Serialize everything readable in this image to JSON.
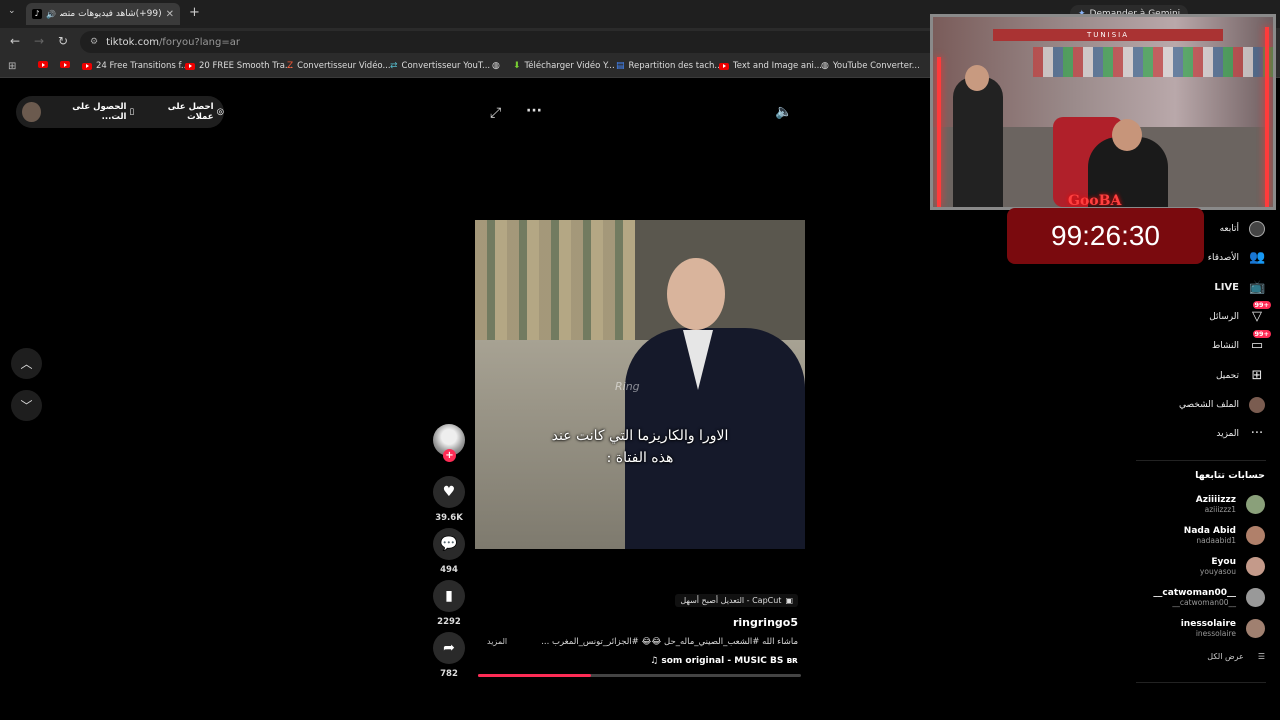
{
  "browser": {
    "tab_title": "(99+)شاهد فيديوهات متصدر",
    "new_tab": "+",
    "gemini_label": "Demander à Gemini",
    "url_host": "tiktok.com",
    "url_path": "/foryou?lang=ar"
  },
  "bookmarks": [
    {
      "label": "",
      "icon": "youtube-icon"
    },
    {
      "label": "",
      "icon": "youtube-icon"
    },
    {
      "label": "24 Free Transitions f...",
      "icon": "youtube-icon"
    },
    {
      "label": "20 FREE Smooth Tra...",
      "icon": "youtube-icon"
    },
    {
      "label": "Convertisseur Vidéo...",
      "icon": "z-icon"
    },
    {
      "label": "Convertisseur YouT...",
      "icon": "arrows-icon"
    },
    {
      "label": "",
      "icon": "globe-icon"
    },
    {
      "label": "Télécharger Vidéo Y...",
      "icon": "download-icon"
    },
    {
      "label": "Repartition des tach...",
      "icon": "docs-icon"
    },
    {
      "label": "Text and Image ani...",
      "icon": "youtube-icon"
    },
    {
      "label": "YouTube Converter...",
      "icon": "globe-icon"
    }
  ],
  "promo": {
    "get_coins": "احصل على عملات",
    "get_app": "الحصول على الت..."
  },
  "video": {
    "caption_line1": "الاورا والكاريزما التي كانت عند",
    "caption_line2": "هذه الفتاة :",
    "watermark": "Ring",
    "likes": "39.6K",
    "comments": "494",
    "saves": "2292",
    "shares": "782",
    "progress": 0.35,
    "capcut_label": "CapCut - التعديل أصبح أسهل",
    "username": "ringringo5",
    "description": "ماشاء الله #الشعب_الصيني_ماله_حل 😂😂 #الجزائر_تونس_المغرب ...",
    "more": "المزيد",
    "music": "♫ som original - MUSIC BS ʙʀ"
  },
  "sidebar": {
    "items": [
      {
        "label": "أتابعه",
        "icon": "following-icon"
      },
      {
        "label": "الأصدقاء",
        "icon": "friends-icon"
      },
      {
        "label": "LIVE",
        "icon": "live-icon"
      },
      {
        "label": "الرسائل",
        "icon": "messages-icon",
        "badge": "99+"
      },
      {
        "label": "النشاط",
        "icon": "activity-icon",
        "badge": "99+"
      },
      {
        "label": "تحميل",
        "icon": "upload-icon"
      },
      {
        "label": "الملف الشخصي",
        "icon": "profile-avatar"
      },
      {
        "label": "المزيد",
        "icon": "more-icon"
      }
    ],
    "followed_title": "حسابات تتابعها",
    "accounts": [
      {
        "name": "Aziiiizzz",
        "handle": "aziiizzz1",
        "color": "#8aa07a"
      },
      {
        "name": "Nada Abid",
        "handle": "nadaabid1",
        "color": "#b0806a"
      },
      {
        "name": "Eyou",
        "handle": "youyasou",
        "color": "#c49a8a"
      },
      {
        "name": "__catwoman00__",
        "handle": "__catwoman00__",
        "color": "#999"
      },
      {
        "name": "inessolaire",
        "handle": "inessolaire",
        "color": "#a08070"
      }
    ],
    "see_all": "عرض الكل"
  },
  "stream": {
    "timer": "99:26:30",
    "cam_banner": "TUNISIA",
    "cam_logo": "GooBA"
  }
}
